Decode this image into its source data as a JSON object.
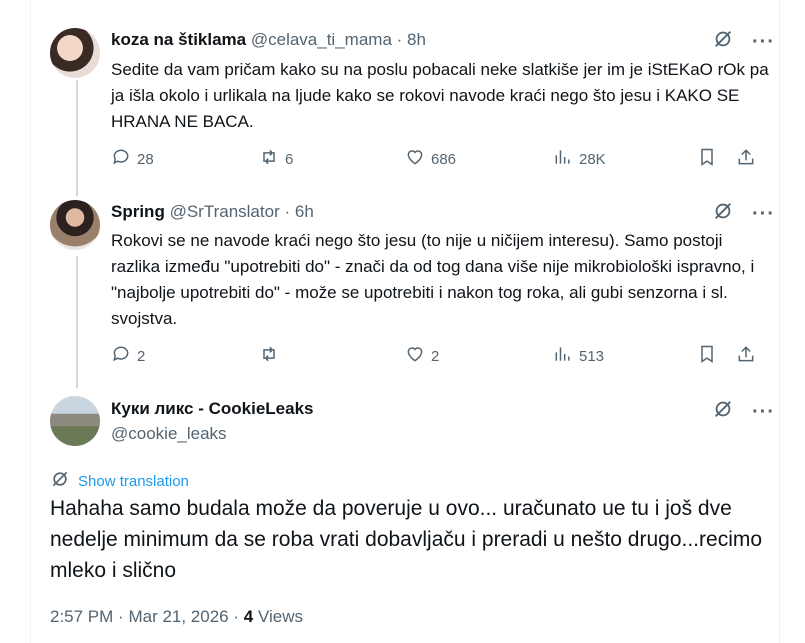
{
  "tweets": [
    {
      "name": "koza na štiklama",
      "handle": "@celava_ti_mama",
      "sep": "·",
      "time": "8h",
      "text": "Sedite da vam pričam kako su na poslu pobacali neke slatkiše jer im je iStEKaO rOk pa ja išla okolo i urlikala na ljude kako se rokovi navode kraći nego što jesu i KAKO SE HRANA NE BACA.",
      "replies": "28",
      "reposts": "6",
      "likes": "686",
      "views": "28K"
    },
    {
      "name": "Spring",
      "handle": "@SrTranslator",
      "sep": "·",
      "time": "6h",
      "text": "Rokovi se ne navode kraći nego što jesu (to nije u ničijem interesu). Samo postoji razlika između \"upotrebiti do\" - znači da od tog dana više nije mikrobiološki ispravno, i \"najbolje upotrebiti do\" - može se upotrebiti i nakon tog roka, ali gubi senzorna i sl. svojstva.",
      "replies": "2",
      "reposts": "",
      "likes": "2",
      "views": "513"
    }
  ],
  "main": {
    "name": "Куки ликс - CookieLeaks",
    "handle": "@cookie_leaks",
    "translate_label": "Show translation",
    "text": "Hahaha samo budala može da poveruje u ovo... uračunato ue tu i još dve nedelje minimum da se roba vrati dobavljaču i preradi u nešto drugo...recimo mleko i slično",
    "time": "2:57 PM",
    "sep1": "·",
    "date": "Mar 21, 2026",
    "sep2": "·",
    "views_count": "4",
    "views_label": "Views"
  },
  "icons": {
    "more": "more-dots-icon",
    "grok": "grok-slash-icon",
    "reply": "reply-bubble-icon",
    "repost": "repost-arrows-icon",
    "like": "heart-icon",
    "views": "views-bars-icon",
    "bookmark": "bookmark-icon",
    "share": "share-upload-icon"
  },
  "colors": {
    "accent": "#1d9bf0",
    "muted": "#536471",
    "text": "#0f1419"
  }
}
